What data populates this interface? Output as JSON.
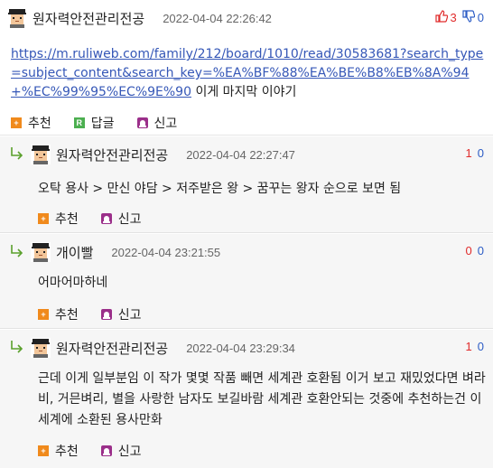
{
  "post": {
    "author": "원자력안전관리전공",
    "date": "2022-04-04 22:26:42",
    "up_count": "3",
    "down_count": "0",
    "link_text": "https://m.ruliweb.com/family/212/board/1010/read/30583681?search_type=subject_content&search_key=%EA%BF%88%EA%BE%B8%EB%8A%94+%EC%99%95%EC%9E%90",
    "text": " 이게 마지막 이야기",
    "actions": {
      "recommend": "추천",
      "reply": "답글",
      "report": "신고"
    },
    "reply_badge": "R"
  },
  "comments": [
    {
      "author": "원자력안전관리전공",
      "date": "2022-04-04 22:27:47",
      "up_count": "1",
      "down_count": "0",
      "text": "오탁 용사 > 만신 야담 > 저주받은 왕 > 꿈꾸는 왕자 순으로 보면 됨",
      "recommend": "추천",
      "report": "신고"
    },
    {
      "author": "개이빨",
      "date": "2022-04-04 23:21:55",
      "up_count": "0",
      "down_count": "0",
      "text": "어마어마하네",
      "recommend": "추천",
      "report": "신고"
    },
    {
      "author": "원자력안전관리전공",
      "date": "2022-04-04 23:29:34",
      "up_count": "1",
      "down_count": "0",
      "text": "근데 이게 일부분임 이 작가 몇몇 작품 빼면 세계관 호환됨 이거 보고 재밌었다면 벼라비, 거믄벼리, 별을 사랑한 남자도 보길바람 세계관 호환안되는 것중에 추천하는건 이세계에 소환된 용사만화",
      "recommend": "추천",
      "report": "신고"
    }
  ],
  "colors": {
    "up": "#e02b2b",
    "down": "#2c5cc5",
    "link": "#3557b7",
    "recommend_icon": "#f08a1c",
    "reply_icon": "#4caf50",
    "report_icon": "#9b2f8a"
  },
  "icons": [
    "avatar-pixel",
    "thumb-up-icon",
    "thumb-down-icon",
    "reply-arrow-icon",
    "plus-icon",
    "reply-icon",
    "report-icon"
  ]
}
